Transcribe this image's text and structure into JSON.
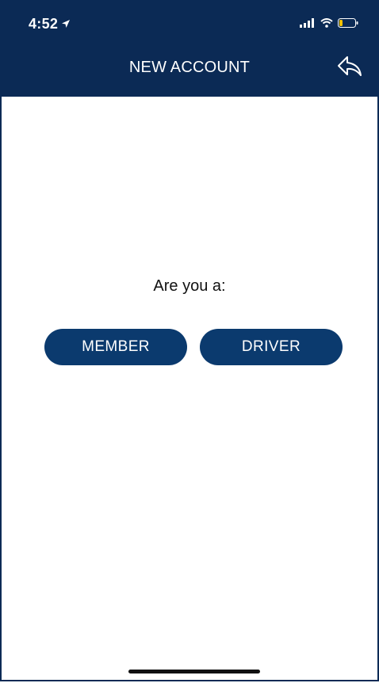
{
  "status_bar": {
    "time": "4:52",
    "location_icon": "location-arrow-icon",
    "signal_icon": "cellular-signal-icon",
    "wifi_icon": "wifi-icon",
    "battery_icon": "battery-low-icon"
  },
  "nav": {
    "title": "NEW ACCOUNT",
    "back_icon": "reply-arrow-icon"
  },
  "main": {
    "prompt": "Are you a:",
    "options": [
      {
        "label": "MEMBER"
      },
      {
        "label": "DRIVER"
      }
    ]
  },
  "colors": {
    "header_bg": "#0b2a55",
    "button_bg": "#0b3a6e",
    "battery_fill": "#f2c200"
  }
}
